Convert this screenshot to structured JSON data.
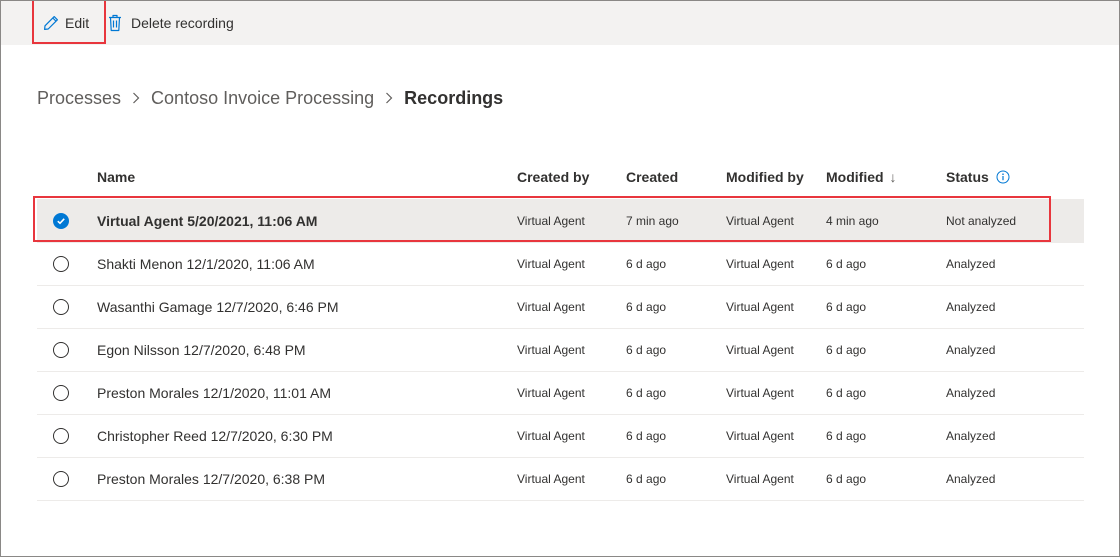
{
  "toolbar": {
    "edit_label": "Edit",
    "delete_label": "Delete recording",
    "edit_icon": "pencil-icon",
    "delete_icon": "trash-icon"
  },
  "breadcrumb": {
    "items": [
      "Processes",
      "Contoso Invoice Processing",
      "Recordings"
    ]
  },
  "table": {
    "columns": {
      "name": "Name",
      "created_by": "Created by",
      "created": "Created",
      "modified_by": "Modified by",
      "modified": "Modified",
      "modified_sort": "↓",
      "status": "Status"
    },
    "rows": [
      {
        "name": "Virtual Agent 5/20/2021, 11:06 AM",
        "created_by": "Virtual Agent",
        "created": "7 min ago",
        "modified_by": "Virtual Agent",
        "modified": "4 min ago",
        "status": "Not analyzed",
        "selected": true
      },
      {
        "name": "Shakti Menon 12/1/2020, 11:06 AM",
        "created_by": "Virtual Agent",
        "created": "6 d ago",
        "modified_by": "Virtual Agent",
        "modified": "6 d ago",
        "status": "Analyzed",
        "selected": false
      },
      {
        "name": "Wasanthi Gamage 12/7/2020, 6:46 PM",
        "created_by": "Virtual Agent",
        "created": "6 d ago",
        "modified_by": "Virtual Agent",
        "modified": "6 d ago",
        "status": "Analyzed",
        "selected": false
      },
      {
        "name": "Egon Nilsson 12/7/2020, 6:48 PM",
        "created_by": "Virtual Agent",
        "created": "6 d ago",
        "modified_by": "Virtual Agent",
        "modified": "6 d ago",
        "status": "Analyzed",
        "selected": false
      },
      {
        "name": "Preston Morales 12/1/2020, 11:01 AM",
        "created_by": "Virtual Agent",
        "created": "6 d ago",
        "modified_by": "Virtual Agent",
        "modified": "6 d ago",
        "status": "Analyzed",
        "selected": false
      },
      {
        "name": "Christopher Reed 12/7/2020, 6:30 PM",
        "created_by": "Virtual Agent",
        "created": "6 d ago",
        "modified_by": "Virtual Agent",
        "modified": "6 d ago",
        "status": "Analyzed",
        "selected": false
      },
      {
        "name": "Preston Morales 12/7/2020, 6:38 PM",
        "created_by": "Virtual Agent",
        "created": "6 d ago",
        "modified_by": "Virtual Agent",
        "modified": "6 d ago",
        "status": "Analyzed",
        "selected": false
      }
    ]
  },
  "colors": {
    "accent": "#0078d4",
    "highlight_border": "#e8363d",
    "toolbar_bg": "#f3f2f1",
    "selected_row_bg": "#edebe9"
  }
}
